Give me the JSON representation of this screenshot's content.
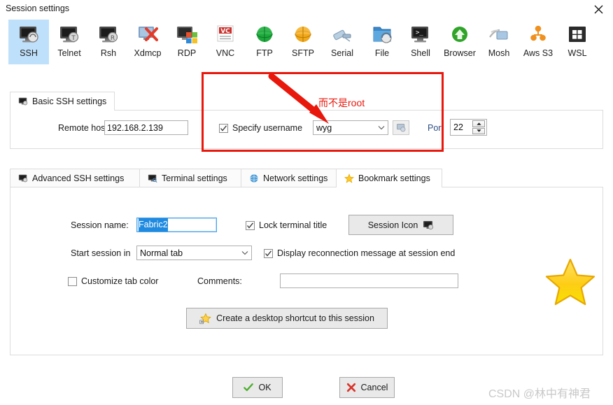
{
  "window": {
    "title": "Session settings",
    "close_icon": "close-icon"
  },
  "session_types": [
    {
      "id": "ssh",
      "label": "SSH",
      "icon": "ssh-icon",
      "selected": true
    },
    {
      "id": "telnet",
      "label": "Telnet",
      "icon": "telnet-icon",
      "selected": false
    },
    {
      "id": "rsh",
      "label": "Rsh",
      "icon": "rsh-icon",
      "selected": false
    },
    {
      "id": "xdmcp",
      "label": "Xdmcp",
      "icon": "xdmcp-icon",
      "selected": false
    },
    {
      "id": "rdp",
      "label": "RDP",
      "icon": "rdp-icon",
      "selected": false
    },
    {
      "id": "vnc",
      "label": "VNC",
      "icon": "vnc-icon",
      "selected": false
    },
    {
      "id": "ftp",
      "label": "FTP",
      "icon": "ftp-icon",
      "selected": false
    },
    {
      "id": "sftp",
      "label": "SFTP",
      "icon": "sftp-icon",
      "selected": false
    },
    {
      "id": "serial",
      "label": "Serial",
      "icon": "serial-icon",
      "selected": false
    },
    {
      "id": "file",
      "label": "File",
      "icon": "file-icon",
      "selected": false
    },
    {
      "id": "shell",
      "label": "Shell",
      "icon": "shell-icon",
      "selected": false
    },
    {
      "id": "browser",
      "label": "Browser",
      "icon": "browser-icon",
      "selected": false
    },
    {
      "id": "mosh",
      "label": "Mosh",
      "icon": "mosh-icon",
      "selected": false
    },
    {
      "id": "awss3",
      "label": "Aws S3",
      "icon": "aws-s3-icon",
      "selected": false
    },
    {
      "id": "wsl",
      "label": "WSL",
      "icon": "wsl-icon",
      "selected": false
    }
  ],
  "basic_ssh": {
    "tab_label": "Basic SSH settings",
    "tab_icon": "monitor-icon",
    "remote_host_label": "Remote host *",
    "remote_host_value": "192.168.2.139",
    "remote_host_placeholder": "",
    "specify_username_label": "Specify username",
    "specify_username_checked": true,
    "username_value": "wyg",
    "username_browse_icon": "user-picker-icon",
    "port_label": "Port",
    "port_value": "22"
  },
  "settings_tabs": [
    {
      "id": "advanced",
      "label": "Advanced SSH settings",
      "icon": "monitor-icon",
      "active": false
    },
    {
      "id": "terminal",
      "label": "Terminal settings",
      "icon": "terminal-icon",
      "active": false
    },
    {
      "id": "network",
      "label": "Network settings",
      "icon": "globe-icon",
      "active": false
    },
    {
      "id": "bookmark",
      "label": "Bookmark settings",
      "icon": "star-icon",
      "active": true
    }
  ],
  "bookmark": {
    "session_name_label": "Session name:",
    "session_name_value": "Fabric2",
    "session_name_selected": true,
    "lock_terminal_title_label": "Lock terminal title",
    "lock_terminal_title_checked": true,
    "session_icon_button_label": "Session Icon",
    "session_icon_button_icon": "monitor-icon",
    "start_session_in_label": "Start session in",
    "start_session_in_value": "Normal tab",
    "start_session_in_options": [
      "Normal tab"
    ],
    "display_reconnection_label": "Display reconnection message at session end",
    "display_reconnection_checked": true,
    "customize_tab_color_label": "Customize tab color",
    "customize_tab_color_checked": false,
    "comments_label": "Comments:",
    "comments_value": "",
    "shortcut_button_label": "Create a desktop shortcut to this session",
    "shortcut_button_icon": "star-shortcut-icon",
    "decoration_icon": "big-star-icon"
  },
  "dialog_buttons": {
    "ok_label": "OK",
    "ok_icon": "green-check-icon",
    "cancel_label": "Cancel",
    "cancel_icon": "red-cross-icon"
  },
  "annotation": {
    "text": "而不是root",
    "color": "#e8180c",
    "arrow_icon": "red-arrow-icon",
    "box_icon": "red-highlight-box"
  },
  "watermark": {
    "text": "CSDN @林中有神君"
  }
}
